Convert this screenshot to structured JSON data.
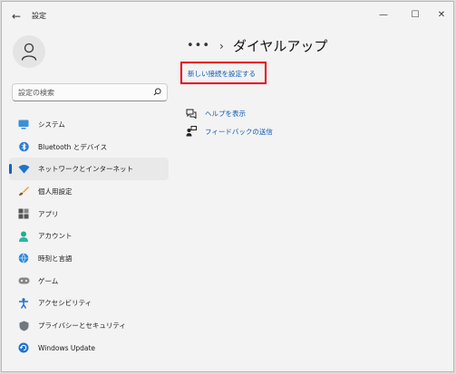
{
  "titlebar": {
    "app_title": "設定",
    "back_glyph": "←",
    "minimize_glyph": "—",
    "maximize_glyph": "☐",
    "close_glyph": "✕"
  },
  "search": {
    "placeholder": "設定の検索"
  },
  "nav": {
    "items": [
      {
        "label": "システム",
        "icon": "monitor-icon",
        "active": false
      },
      {
        "label": "Bluetooth とデバイス",
        "icon": "bluetooth-icon",
        "active": false
      },
      {
        "label": "ネットワークとインターネット",
        "icon": "wifi-icon",
        "active": true
      },
      {
        "label": "個人用設定",
        "icon": "brush-icon",
        "active": false
      },
      {
        "label": "アプリ",
        "icon": "apps-icon",
        "active": false
      },
      {
        "label": "アカウント",
        "icon": "account-icon",
        "active": false
      },
      {
        "label": "時刻と言語",
        "icon": "globe-clock-icon",
        "active": false
      },
      {
        "label": "ゲーム",
        "icon": "gamepad-icon",
        "active": false
      },
      {
        "label": "アクセシビリティ",
        "icon": "accessibility-icon",
        "active": false
      },
      {
        "label": "プライバシーとセキュリティ",
        "icon": "shield-icon",
        "active": false
      },
      {
        "label": "Windows Update",
        "icon": "update-icon",
        "active": false
      }
    ]
  },
  "main": {
    "breadcrumb_more": "•••",
    "breadcrumb_sep": "›",
    "title": "ダイヤルアップ",
    "setup_link": "新しい接続を設定する",
    "help_link": "ヘルプを表示",
    "feedback_link": "フィードバックの送信"
  },
  "colors": {
    "accent": "#0067c0",
    "link": "#0a5ab5",
    "highlight_box": "#e60012"
  }
}
